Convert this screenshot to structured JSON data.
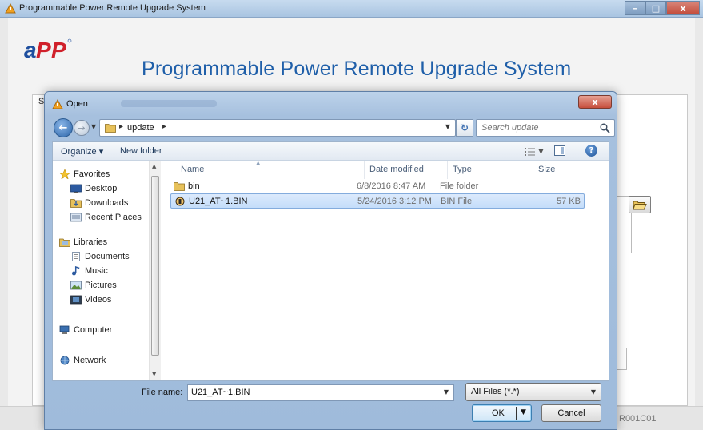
{
  "app": {
    "window_title": "Programmable Power Remote Upgrade System",
    "heading": "Programmable Power Remote Upgrade System",
    "logo_text": "APP",
    "tab_first_letter": "S",
    "version": "R001C01",
    "window_buttons": {
      "minimize": "–",
      "maximize": "□",
      "close": "x"
    }
  },
  "dialog": {
    "title": "Open",
    "close_glyph": "x",
    "address": {
      "path": "update"
    },
    "search_placeholder": "Search update",
    "toolbar": {
      "organize": "Organize ▾",
      "new_folder": "New folder"
    },
    "nav_pane": {
      "favorites": "Favorites",
      "favorites_items": [
        "Desktop",
        "Downloads",
        "Recent Places"
      ],
      "libraries": "Libraries",
      "libraries_items": [
        "Documents",
        "Music",
        "Pictures",
        "Videos"
      ],
      "computer": "Computer",
      "network": "Network"
    },
    "columns": {
      "name": "Name",
      "date": "Date modified",
      "type": "Type",
      "size": "Size"
    },
    "files": [
      {
        "name": "bin",
        "date": "6/8/2016 8:47 AM",
        "type": "File folder",
        "size": "",
        "icon": "folder-icon",
        "selected": false
      },
      {
        "name": "U21_AT~1.BIN",
        "date": "5/24/2016 3:12 PM",
        "type": "BIN File",
        "size": "57 KB",
        "icon": "bin-file-icon",
        "selected": true
      }
    ],
    "file_name_label": "File name:",
    "file_name_value": "U21_AT~1.BIN",
    "file_type": "All Files (*.*)",
    "ok_label": "OK",
    "cancel_label": "Cancel"
  },
  "colors": {
    "heading_blue": "#1f5fa9",
    "logo_blue": "#1f4f9e",
    "logo_red": "#d0202a",
    "selection": "#c4ddfa"
  }
}
